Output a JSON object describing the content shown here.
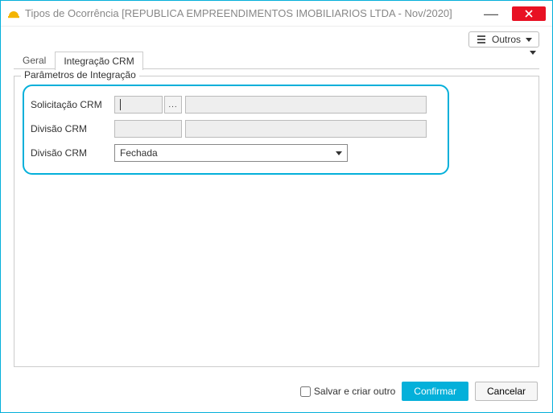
{
  "window": {
    "title": "Tipos de Ocorrência [REPUBLICA EMPREENDIMENTOS IMOBILIARIOS LTDA - Nov/2020]"
  },
  "toolbar": {
    "outros_label": "Outros"
  },
  "tabs": {
    "geral": "Geral",
    "integracao": "Integração CRM"
  },
  "groupbox": {
    "legend": "Parâmetros de Integração"
  },
  "fields": {
    "solicitacao_label": "Solicitação CRM",
    "solicitacao_code": "",
    "solicitacao_desc": "",
    "divisao1_label": "Divisão CRM",
    "divisao1_code": "",
    "divisao1_desc": "",
    "divisao2_label": "Divisão CRM",
    "divisao2_value": "Fechada"
  },
  "footer": {
    "save_another_label": "Salvar e criar outro",
    "confirm_label": "Confirmar",
    "cancel_label": "Cancelar"
  },
  "lookup_ellipsis": "..."
}
